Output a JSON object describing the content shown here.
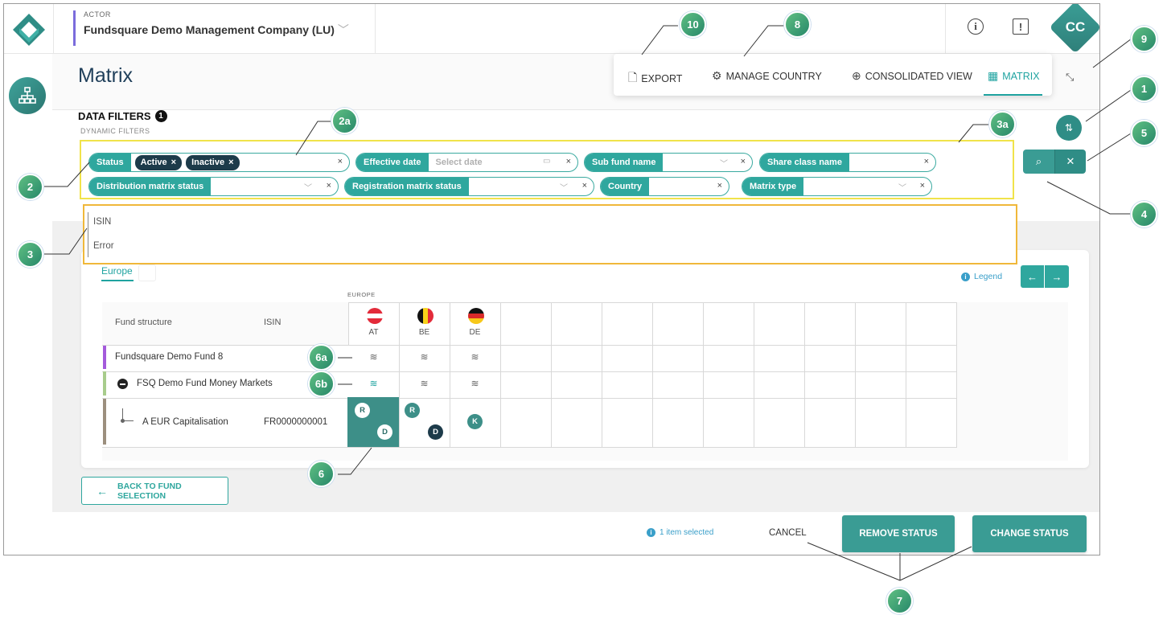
{
  "header": {
    "actor_caption": "ACTOR",
    "actor_name": "Fundsquare Demo Management Company (LU)",
    "avatar_initials": "CC"
  },
  "page": {
    "title": "Matrix"
  },
  "toolbar": {
    "export": "EXPORT",
    "manage_country": "MANAGE COUNTRY",
    "consolidated_view": "CONSOLIDATED VIEW",
    "matrix": "MATRIX"
  },
  "filters": {
    "title": "DATA FILTERS",
    "count": "1",
    "subtitle": "DYNAMIC FILTERS",
    "status_label": "Status",
    "status_tags": [
      "Active",
      "Inactive"
    ],
    "effective_date_label": "Effective date",
    "effective_date_placeholder": "Select date",
    "sub_fund_label": "Sub fund name",
    "share_class_label": "Share class name",
    "distribution_label": "Distribution matrix status",
    "registration_label": "Registration matrix status",
    "country_label": "Country",
    "matrix_type_label": "Matrix type"
  },
  "dropdown": {
    "items": [
      "ISIN",
      "Error"
    ]
  },
  "matrix": {
    "tab": "Europe",
    "legend": "Legend",
    "region": "EUROPE",
    "col_fund_structure": "Fund structure",
    "col_isin": "ISIN",
    "countries": [
      "AT",
      "BE",
      "DE"
    ],
    "rows": [
      {
        "name": "Fundsquare Demo Fund 8",
        "isin": ""
      },
      {
        "name": "FSQ Demo Fund Money Markets",
        "isin": ""
      },
      {
        "name": "A EUR Capitalisation",
        "isin": "FR0000000001"
      }
    ],
    "statuses": {
      "at": [
        "R",
        "D"
      ],
      "be": [
        "R",
        "D"
      ],
      "de": [
        "K"
      ]
    }
  },
  "footer": {
    "back": "BACK TO FUND SELECTION",
    "selected": "1 item selected",
    "cancel": "CANCEL",
    "remove": "REMOVE STATUS",
    "change": "CHANGE STATUS"
  },
  "callouts": [
    "10",
    "8",
    "9",
    "1",
    "2a",
    "3a",
    "5",
    "2",
    "4",
    "3",
    "6a",
    "6b",
    "6",
    "7"
  ],
  "colors": {
    "accent": "#2fa79e",
    "callout": "#3aa37a",
    "filter_box": "#f0e34a",
    "dropdown_box": "#f0b83a",
    "selected_cell": "#3d8f88"
  }
}
